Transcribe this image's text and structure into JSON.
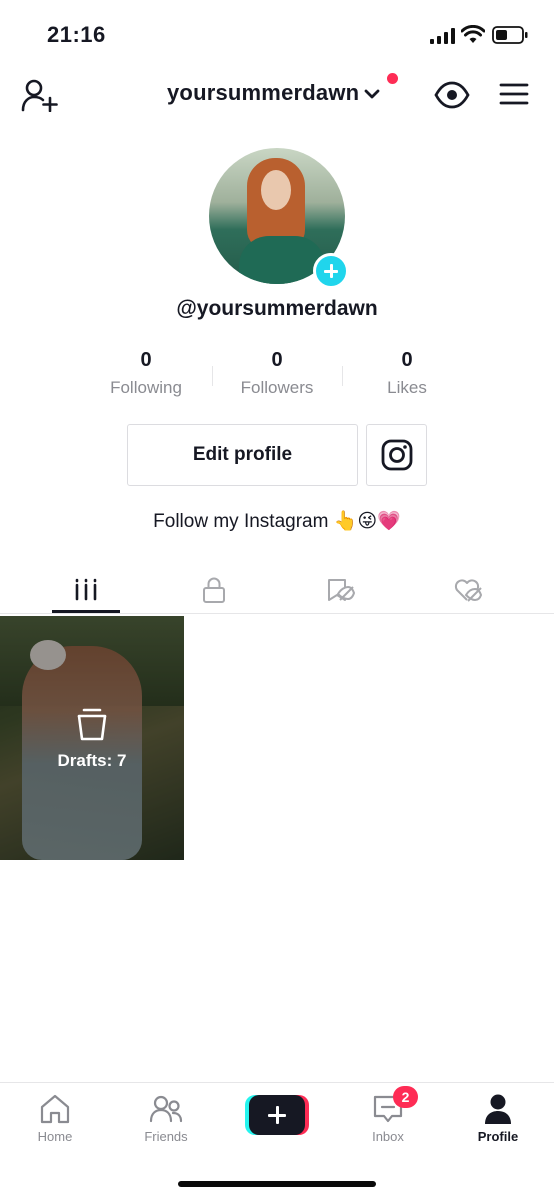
{
  "status_bar": {
    "time": "21:16",
    "icons": [
      "cellular-signal-icon",
      "wifi-icon",
      "battery-icon"
    ]
  },
  "header": {
    "username": "yoursummerdawn",
    "icons": [
      "add-friend-icon",
      "chevron-down-icon",
      "eye-icon",
      "hamburger-menu-icon"
    ],
    "notification_dot_color": "#fe2c55"
  },
  "profile": {
    "handle": "@yoursummerdawn",
    "stats": [
      {
        "value": "0",
        "label": "Following"
      },
      {
        "value": "0",
        "label": "Followers"
      },
      {
        "value": "0",
        "label": "Likes"
      }
    ],
    "edit_button_label": "Edit profile",
    "instagram_icon": "instagram-icon",
    "bio": "Follow my Instagram 👆😜💗"
  },
  "tabs": [
    {
      "icon": "grid-videos-icon",
      "active": true
    },
    {
      "icon": "lock-icon",
      "active": false
    },
    {
      "icon": "favorites-hidden-icon",
      "active": false
    },
    {
      "icon": "liked-hidden-icon",
      "active": false
    }
  ],
  "grid": {
    "drafts_label": "Drafts: 7",
    "drafts_icon": "drafts-box-icon"
  },
  "bottom_nav": {
    "items": [
      {
        "label": "Home",
        "icon": "home-icon",
        "active": false
      },
      {
        "label": "Friends",
        "icon": "friends-icon",
        "active": false
      },
      {
        "label": "",
        "icon": "create-plus-icon",
        "active": false
      },
      {
        "label": "Inbox",
        "icon": "inbox-icon",
        "active": false,
        "badge": "2"
      },
      {
        "label": "Profile",
        "icon": "profile-icon",
        "active": true
      }
    ]
  },
  "colors": {
    "accent_pink": "#fe2c55",
    "accent_cyan": "#25f4ee",
    "text_primary": "#161823",
    "text_secondary": "#8a8b91"
  }
}
